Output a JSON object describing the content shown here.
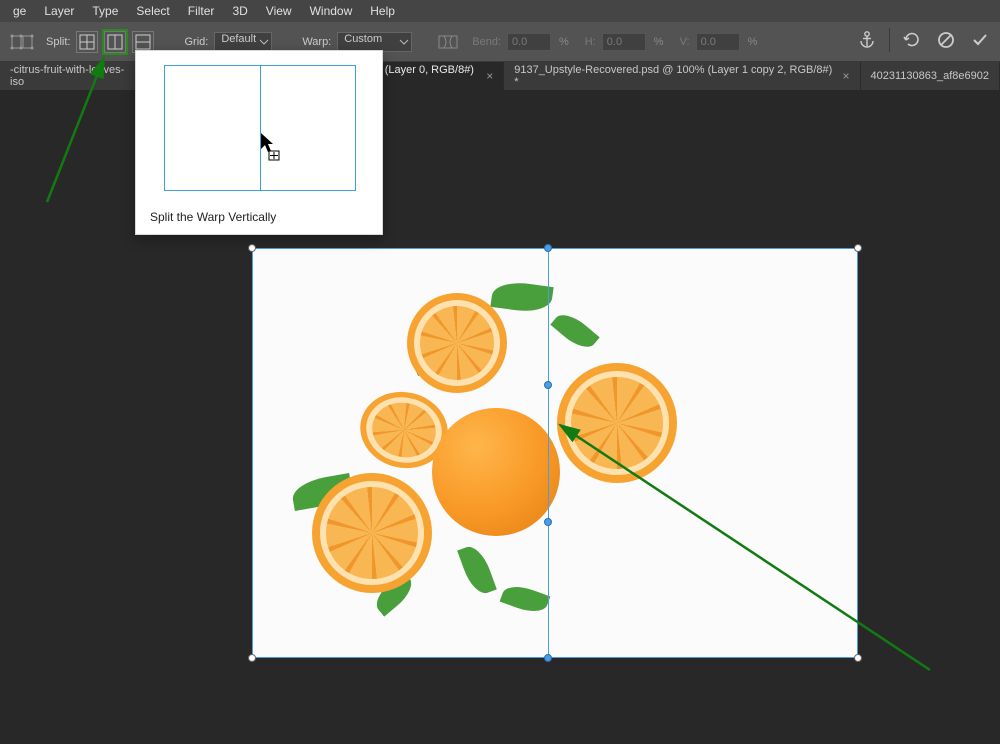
{
  "menu": {
    "items": [
      "ge",
      "Layer",
      "Type",
      "Select",
      "Filter",
      "3D",
      "View",
      "Window",
      "Help"
    ]
  },
  "toolbar": {
    "split_label": "Split:",
    "grid_label": "Grid:",
    "grid_value": "Default",
    "warp_label": "Warp:",
    "warp_value": "Custom",
    "bend_label": "Bend:",
    "bend_value": "0.0",
    "h_label": "H:",
    "h_value": "0.0",
    "v_label": "V:",
    "v_value": "0.0",
    "percent": "%"
  },
  "tabs": [
    {
      "label": "-citrus-fruit-with-leaves-iso",
      "close": "×",
      "active": false,
      "truncated": true
    },
    {
      "label": "s (Layer 0, RGB/8#) *",
      "close": "×",
      "active": true
    },
    {
      "label": "9137_Upstyle-Recovered.psd @ 100% (Layer 1 copy 2, RGB/8#) *",
      "close": "×",
      "active": false
    },
    {
      "label": "40231130863_af8e6902",
      "close": "",
      "active": false,
      "truncated": true
    }
  ],
  "tooltip": {
    "text": "Split the Warp Vertically"
  },
  "annotation": {
    "color": "#117a11"
  }
}
